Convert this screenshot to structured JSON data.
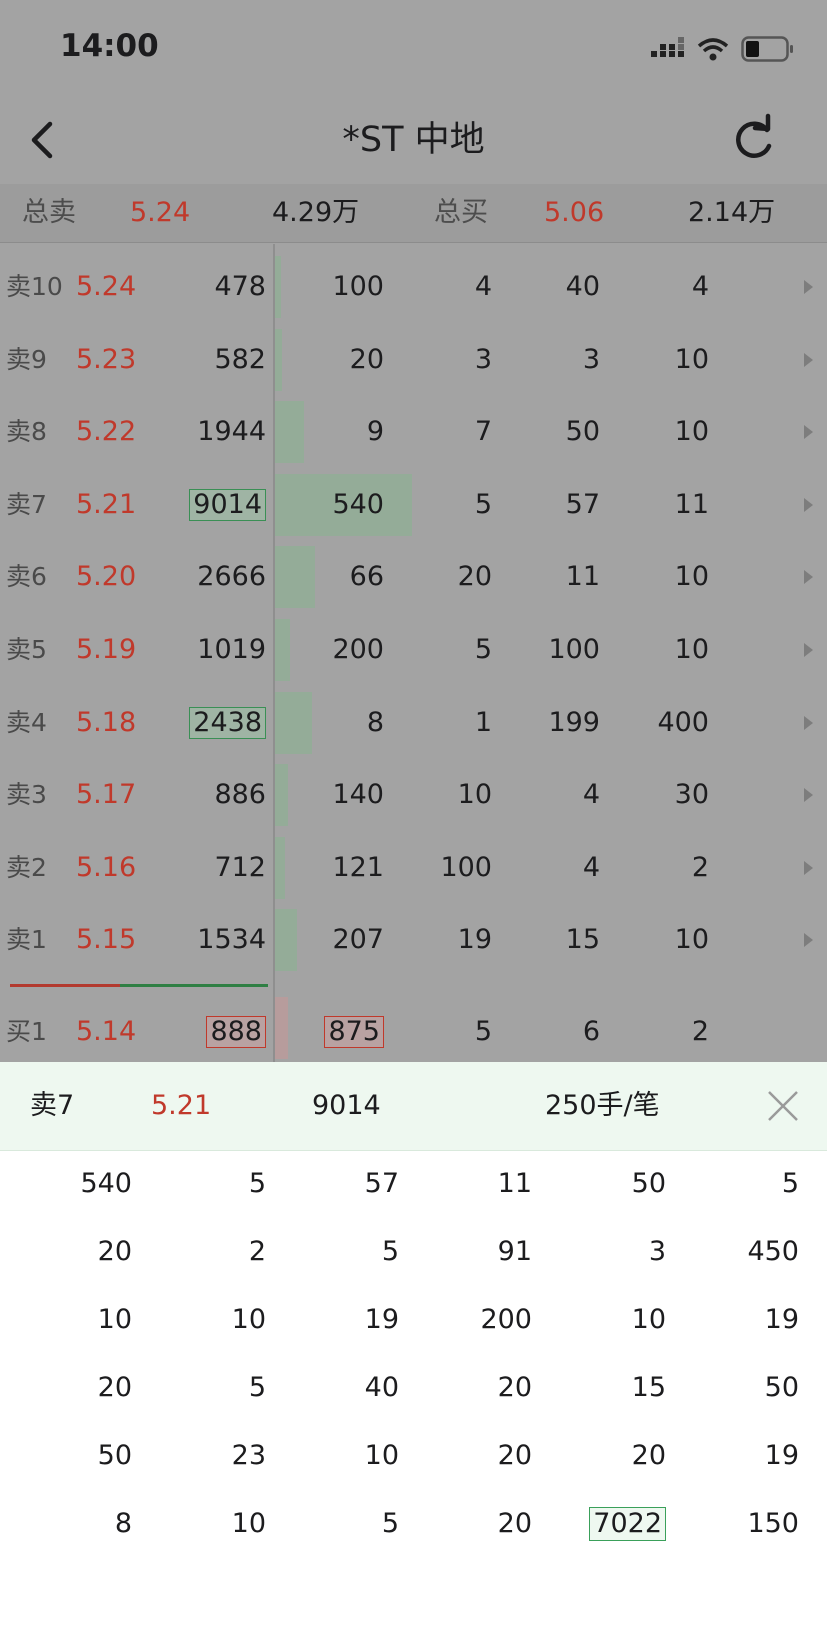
{
  "status_bar": {
    "time": "14:00"
  },
  "nav": {
    "title": "*ST 中地"
  },
  "summary": {
    "sell_label": "总卖",
    "sell_price": "5.24",
    "sell_amount": "4.29万",
    "buy_label": "总买",
    "buy_price": "5.06",
    "buy_amount": "2.14万"
  },
  "order_book": {
    "columns": [
      "level",
      "price",
      "volume",
      "order_1",
      "order_2",
      "order_3",
      "order_4"
    ],
    "rows": [
      {
        "level": "卖10",
        "price": "5.24",
        "volume": "478",
        "orders": [
          "100",
          "4",
          "40",
          "4"
        ],
        "bar_share": 0.01,
        "highlight": false
      },
      {
        "level": "卖9",
        "price": "5.23",
        "volume": "582",
        "orders": [
          "20",
          "3",
          "3",
          "10"
        ],
        "bar_share": 0.013,
        "highlight": false
      },
      {
        "level": "卖8",
        "price": "5.22",
        "volume": "1944",
        "orders": [
          "9",
          "7",
          "50",
          "10"
        ],
        "bar_share": 0.054,
        "highlight": false
      },
      {
        "level": "卖7",
        "price": "5.21",
        "volume": "9014",
        "orders": [
          "540",
          "5",
          "57",
          "11"
        ],
        "bar_share": 0.253,
        "highlight": true
      },
      {
        "level": "卖6",
        "price": "5.20",
        "volume": "2666",
        "orders": [
          "66",
          "20",
          "11",
          "10"
        ],
        "bar_share": 0.074,
        "highlight": false
      },
      {
        "level": "卖5",
        "price": "5.19",
        "volume": "1019",
        "orders": [
          "200",
          "5",
          "100",
          "10"
        ],
        "bar_share": 0.028,
        "highlight": false
      },
      {
        "level": "卖4",
        "price": "5.18",
        "volume": "2438",
        "orders": [
          "8",
          "1",
          "199",
          "400"
        ],
        "bar_share": 0.068,
        "highlight": true
      },
      {
        "level": "卖3",
        "price": "5.17",
        "volume": "886",
        "orders": [
          "140",
          "10",
          "4",
          "30"
        ],
        "bar_share": 0.024,
        "highlight": false
      },
      {
        "level": "卖2",
        "price": "5.16",
        "volume": "712",
        "orders": [
          "121",
          "100",
          "4",
          "2"
        ],
        "bar_share": 0.019,
        "highlight": false
      },
      {
        "level": "卖1",
        "price": "5.15",
        "volume": "1534",
        "orders": [
          "207",
          "19",
          "15",
          "10"
        ],
        "bar_share": 0.041,
        "highlight": false
      }
    ],
    "buy_rows": [
      {
        "level": "买1",
        "price": "5.14",
        "volume": "888",
        "orders": [
          "875",
          "5",
          "6",
          "2"
        ],
        "bar_share": 0.024
      }
    ]
  },
  "detail": {
    "level": "卖7",
    "price": "5.21",
    "volume": "9014",
    "avg": "250手/笔",
    "grid": [
      [
        "540",
        "5",
        "57",
        "11",
        "50",
        "5"
      ],
      [
        "20",
        "2",
        "5",
        "91",
        "3",
        "450"
      ],
      [
        "10",
        "10",
        "19",
        "200",
        "10",
        "19"
      ],
      [
        "20",
        "5",
        "40",
        "20",
        "15",
        "50"
      ],
      [
        "50",
        "23",
        "10",
        "20",
        "20",
        "19"
      ],
      [
        "8",
        "10",
        "5",
        "20",
        "7022",
        "150"
      ]
    ],
    "highlight_value": "7022"
  },
  "colors": {
    "price_red": "#c0392b",
    "sell_green": "#3a8f55",
    "panel_bg": "#eef8f0"
  },
  "icons": [
    "back-icon",
    "refresh-icon",
    "signal-icon",
    "wifi-icon",
    "battery-icon",
    "close-icon",
    "expand-arrow-icon"
  ]
}
